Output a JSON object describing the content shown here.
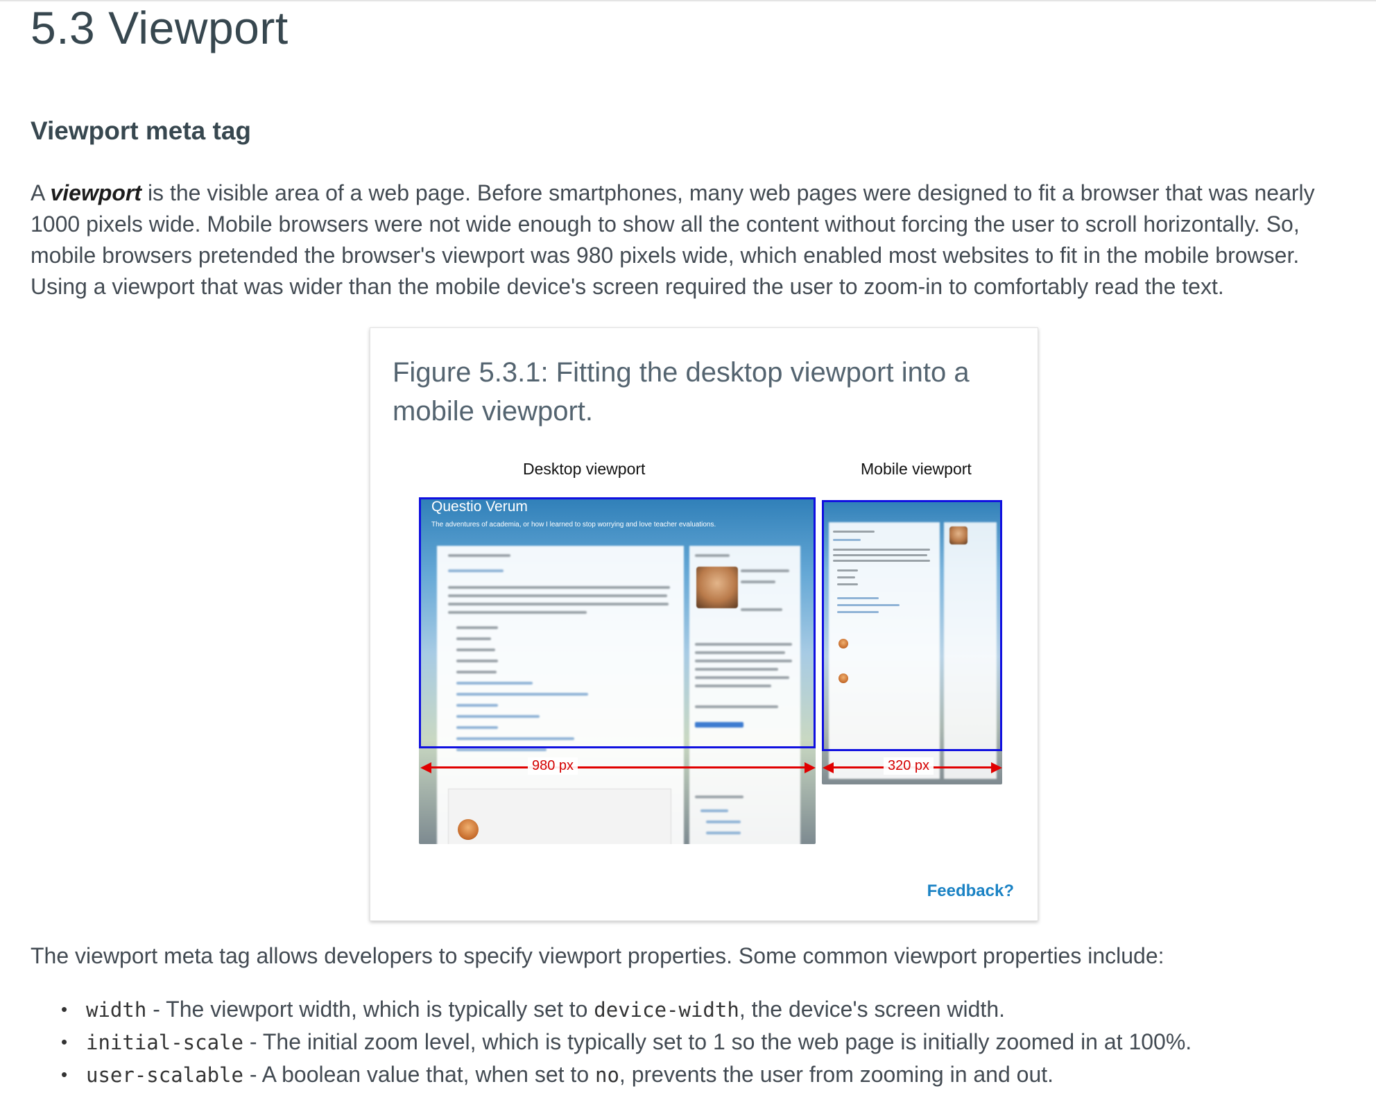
{
  "section_title": "5.3 Viewport",
  "subheading": "Viewport meta tag",
  "intro": {
    "before": "A ",
    "term": "viewport",
    "after": " is the visible area of a web page. Before smartphones, many web pages were designed to fit a browser that was nearly 1000 pixels wide. Mobile browsers were not wide enough to show all the content without forcing the user to scroll horizontally. So, mobile browsers pretended the browser's viewport was 980 pixels wide, which enabled most websites to fit in the mobile browser. Using a viewport that was wider than the mobile device's screen required the user to zoom-in to comfortably read the text."
  },
  "figure": {
    "caption": "Figure 5.3.1: Fitting the desktop viewport into a mobile viewport.",
    "desktop_label": "Desktop viewport",
    "mobile_label": "Mobile viewport",
    "blog_title": "Questio Verum",
    "blog_subtitle": "The adventures of academia, or how I learned to stop worrying and love teacher evaluations.",
    "desktop_width_label": "980 px",
    "mobile_width_label": "320 px",
    "feedback_label": "Feedback?",
    "colors": {
      "viewport_frame": "#1010e0",
      "arrow": "#e00000",
      "feedback_link": "#1a82c4"
    }
  },
  "lead": "The viewport meta tag allows developers to specify viewport properties. Some common viewport properties include:",
  "properties": [
    {
      "name": "width",
      "pre": " - The viewport width, which is typically set to ",
      "code": "device-width",
      "post": ", the device's screen width."
    },
    {
      "name": "initial-scale",
      "pre": " - The initial zoom level, which is typically set to 1 so the web page is initially zoomed in at 100%.",
      "code": "",
      "post": ""
    },
    {
      "name": "user-scalable",
      "pre": " - A boolean value that, when set to ",
      "code": "no",
      "post": ", prevents the user from zooming in and out."
    }
  ]
}
